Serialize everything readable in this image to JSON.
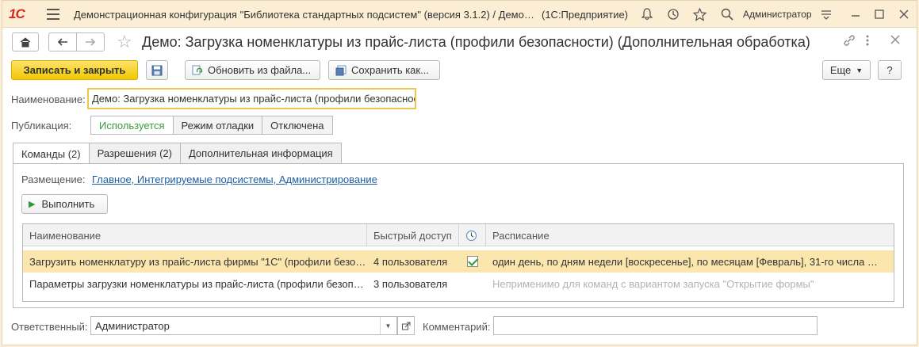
{
  "titlebar": {
    "logo": "1С",
    "title": "Демонстрационная конфигурация \"Библиотека стандартных подсистем\" (версия 3.1.2) / Демо…",
    "app": "(1С:Предприятие)",
    "user": "Администратор"
  },
  "form": {
    "title": "Демо: Загрузка номенклатуры из прайс-листа (профили безопасности) (Дополнительная обработка)"
  },
  "toolbar": {
    "save_close": "Записать и закрыть",
    "update_from_file": "Обновить из файла...",
    "save_as": "Сохранить как...",
    "more": "Еще",
    "help": "?"
  },
  "name_field": {
    "label": "Наименование:",
    "value": "Демо: Загрузка номенклатуры из прайс-листа (профили безопаснос"
  },
  "publication": {
    "label": "Публикация:",
    "options": [
      "Используется",
      "Режим отладки",
      "Отключена"
    ],
    "selected": "Используется"
  },
  "tabs": [
    {
      "label": "Команды (2)"
    },
    {
      "label": "Разрешения (2)"
    },
    {
      "label": "Дополнительная информация"
    }
  ],
  "commands": {
    "placement_label": "Размещение:",
    "placement_value": "Главное, Интегрируемые подсистемы, Администрирование",
    "run_button": "Выполнить",
    "columns": [
      "Наименование",
      "Быстрый доступ",
      "",
      "Расписание"
    ],
    "rows": [
      {
        "name": "Загрузить номенклатуру из прайс-листа фирмы \"1С\" (профили безо…",
        "quick_access": "4 пользователя",
        "scheduled": true,
        "schedule": "один день, по дням недели [воскресенье], по месяцам [Февраль], 31-го числа …"
      },
      {
        "name": "Параметры загрузки номенклатуры из прайс-листа (профили безоп…",
        "quick_access": "3 пользователя",
        "scheduled": false,
        "schedule": "Неприменимо для команд с вариантом запуска \"Открытие формы\""
      }
    ]
  },
  "footer": {
    "responsible_label": "Ответственный:",
    "responsible_value": "Администратор",
    "comment_label": "Комментарий:",
    "comment_value": ""
  }
}
